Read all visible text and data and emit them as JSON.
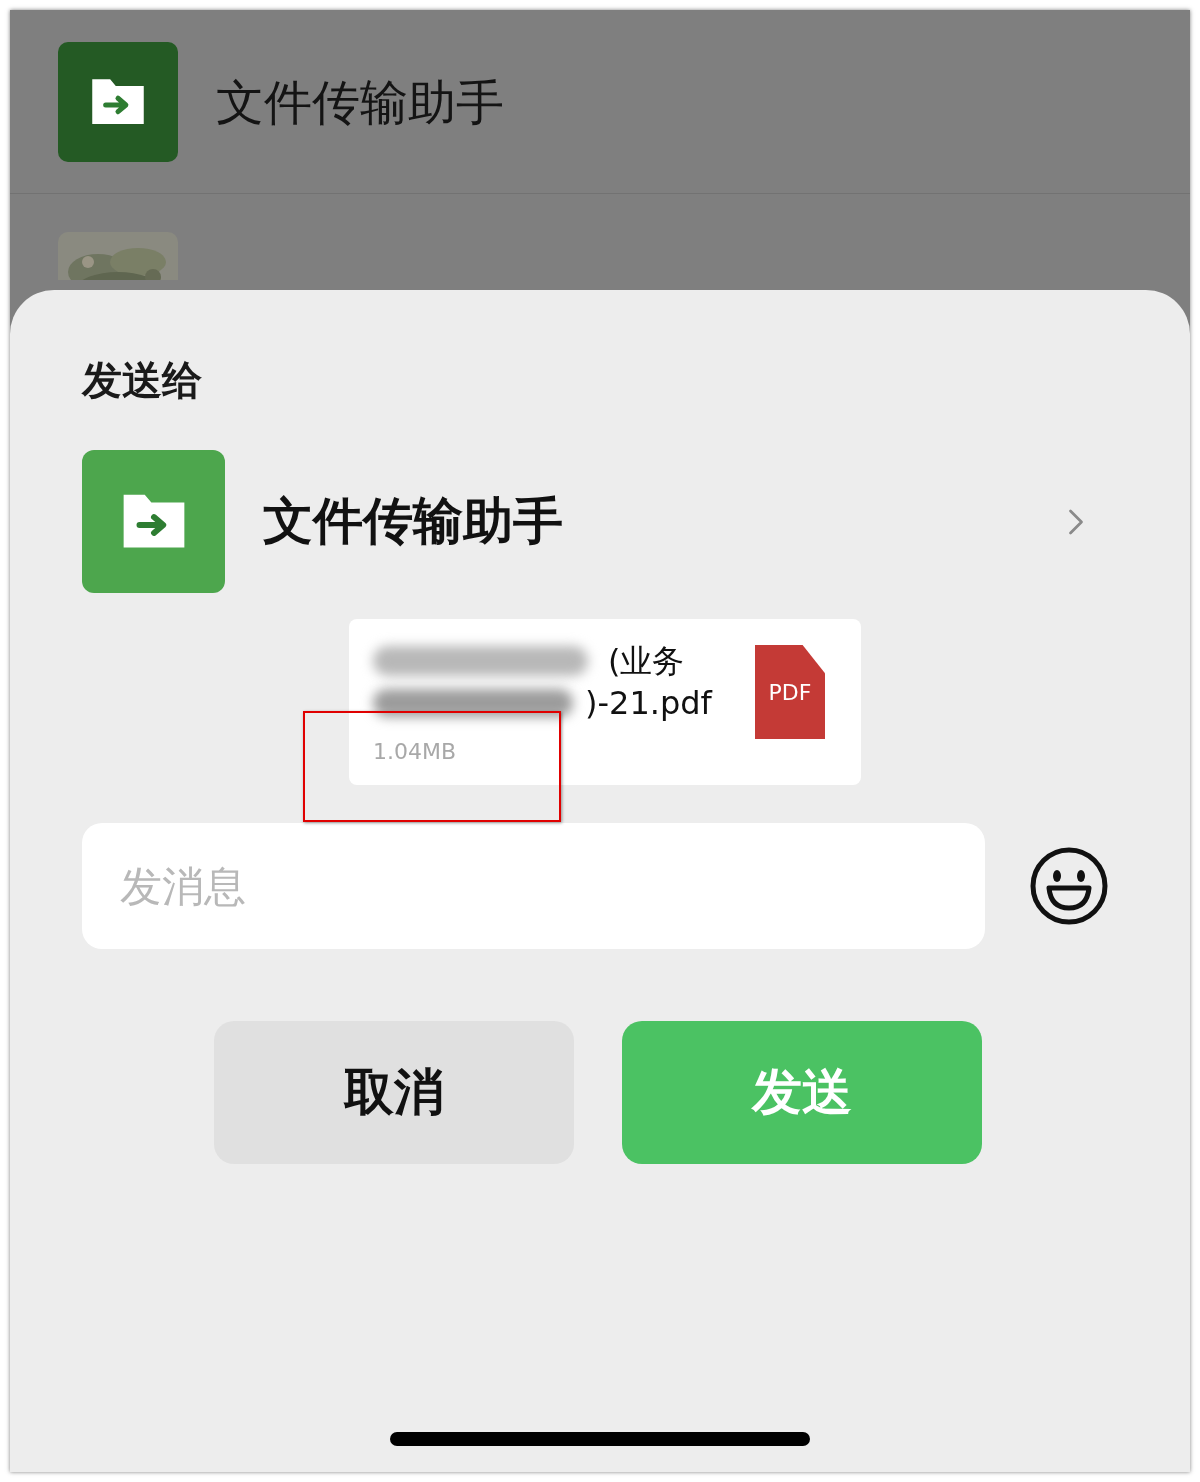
{
  "chat_list": [
    {
      "kind": "folder",
      "name": "文件传输助手"
    },
    {
      "kind": "picture"
    }
  ],
  "share_sheet": {
    "title": "发送给",
    "recipient": {
      "name": "文件传输助手"
    },
    "file": {
      "name_lines": [
        "(业务",
        ")-21.pdf"
      ],
      "size": "1.04MB",
      "type_badge": "PDF"
    },
    "message": {
      "placeholder": "发消息"
    },
    "buttons": [
      {
        "kind": "cancel",
        "label": "取消"
      },
      {
        "kind": "send",
        "label": "发送"
      }
    ]
  }
}
